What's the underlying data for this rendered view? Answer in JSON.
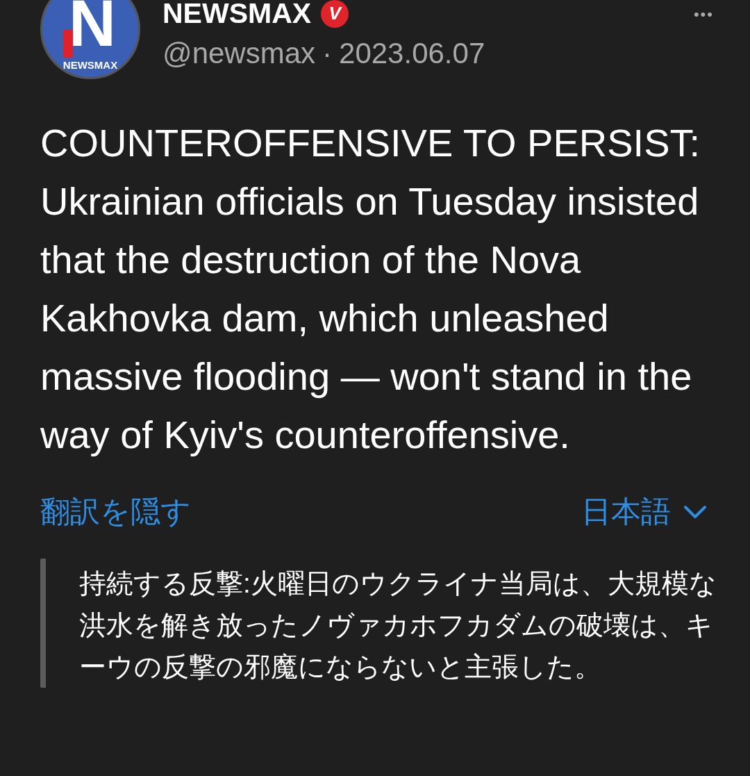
{
  "post": {
    "avatar": {
      "letter": "N",
      "label": "NEWSMAX"
    },
    "name": "NEWSMAX",
    "badge": "V",
    "handle": "@newsmax",
    "separator": "·",
    "date": "2023.06.07",
    "menu": "•••",
    "text": "COUNTEROFFENSIVE TO PERSIST: Ukrainian officials on Tuesday insisted that the destruction of the Nova Kakhovka dam, which unleashed massive flooding — won't stand in the way of Kyiv's counteroffensive.",
    "translation": {
      "hide_link": "翻訳を隠す",
      "language": "日本語",
      "text": "持続する反撃:火曜日のウクライナ当局は、大規模な洪水を解き放ったノヴァカホフカダムの破壊は、キーウの反撃の邪魔にならないと主張した。"
    }
  }
}
